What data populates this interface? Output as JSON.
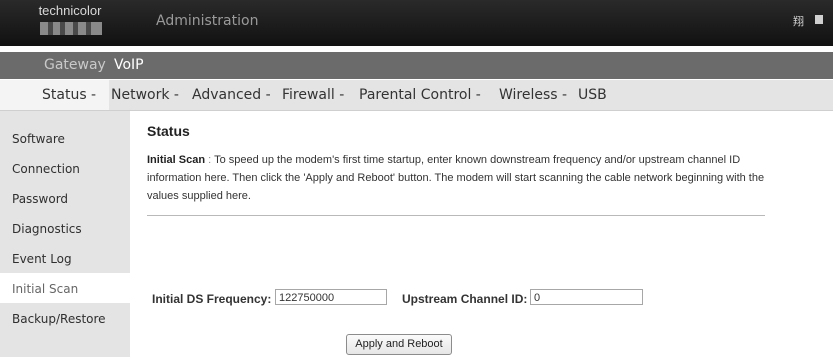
{
  "header": {
    "logo_text": "technicolor",
    "title": "Administration",
    "lang_icon": "翔"
  },
  "subtabs": [
    {
      "label": "Gateway"
    },
    {
      "label": "VoIP"
    }
  ],
  "nav": {
    "items": [
      {
        "label": "Status -"
      },
      {
        "label": "Network -"
      },
      {
        "label": "Advanced -"
      },
      {
        "label": "Firewall -"
      },
      {
        "label": "Parental Control -"
      },
      {
        "label": "Wireless -"
      },
      {
        "label": "USB"
      }
    ]
  },
  "sidebar": {
    "items": [
      {
        "label": "Software"
      },
      {
        "label": "Connection"
      },
      {
        "label": "Password"
      },
      {
        "label": "Diagnostics"
      },
      {
        "label": "Event Log"
      },
      {
        "label": "Initial Scan"
      },
      {
        "label": "Backup/Restore"
      }
    ]
  },
  "main": {
    "heading": "Status",
    "intro_title": "Initial Scan",
    "intro_sep": ":",
    "intro_text": "To speed up the modem's first time startup, enter known downstream frequency and/or upstream channel ID information here. Then click the 'Apply and Reboot' button. The modem will start scanning the cable network beginning with the values supplied here."
  },
  "form": {
    "ds_label": "Initial DS Frequency:",
    "ds_value": "122750000",
    "us_label": "Upstream Channel ID:",
    "us_value": "0",
    "apply_label": "Apply and Reboot"
  }
}
